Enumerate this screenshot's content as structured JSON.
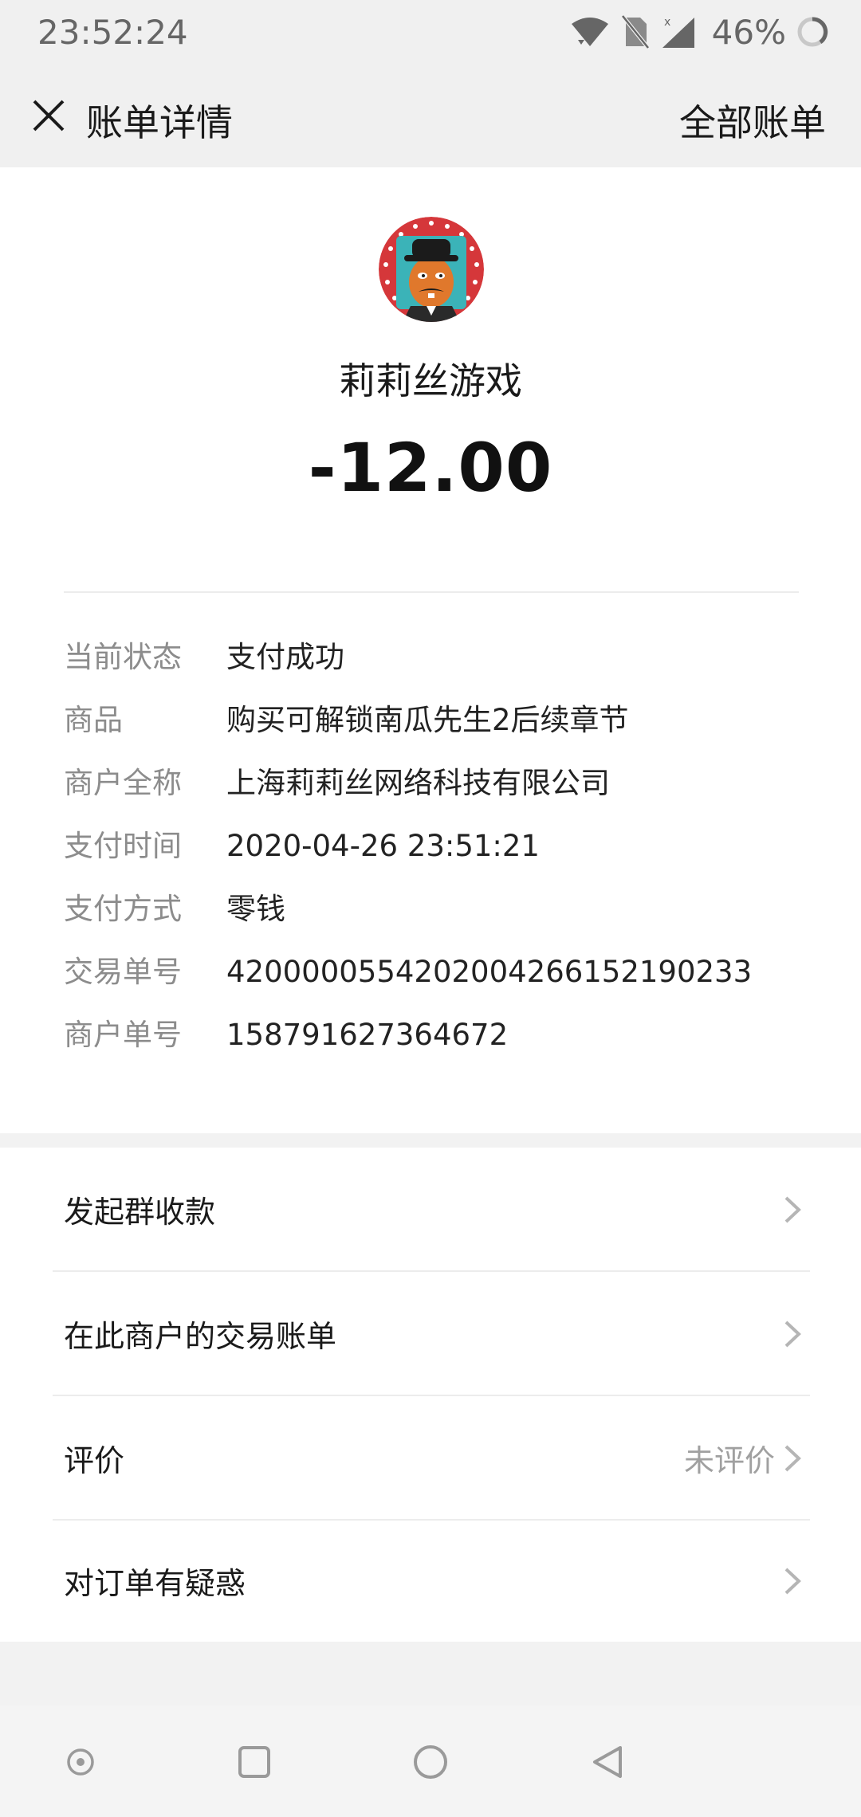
{
  "status_bar": {
    "time": "23:52:24",
    "battery": "46%",
    "icons": [
      "wifi-icon",
      "no-sim-icon",
      "signal-icon",
      "battery-icon"
    ]
  },
  "header": {
    "title": "账单详情",
    "action": "全部账单",
    "close_icon": "close-icon"
  },
  "merchant": {
    "name": "莉莉丝游戏",
    "amount": "-12.00"
  },
  "details": [
    {
      "label": "当前状态",
      "value": "支付成功"
    },
    {
      "label": "商品",
      "value": "购买可解锁南瓜先生2后续章节"
    },
    {
      "label": "商户全称",
      "value": "上海莉莉丝网络科技有限公司"
    },
    {
      "label": "支付时间",
      "value": "2020-04-26 23:51:21"
    },
    {
      "label": "支付方式",
      "value": "零钱"
    },
    {
      "label": "交易单号",
      "value": "4200000554202004266152190233"
    },
    {
      "label": "商户单号",
      "value": "158791627364672"
    }
  ],
  "menu": [
    {
      "label": "发起群收款",
      "status": ""
    },
    {
      "label": "在此商户的交易账单",
      "status": ""
    },
    {
      "label": "评价",
      "status": "未评价"
    },
    {
      "label": "对订单有疑惑",
      "status": ""
    }
  ],
  "nav": [
    "assist-icon",
    "recents-icon",
    "home-icon",
    "back-icon"
  ],
  "colors": {
    "background": "#f2f2f2",
    "card": "#ffffff",
    "label_gray": "#8c8c8c"
  }
}
